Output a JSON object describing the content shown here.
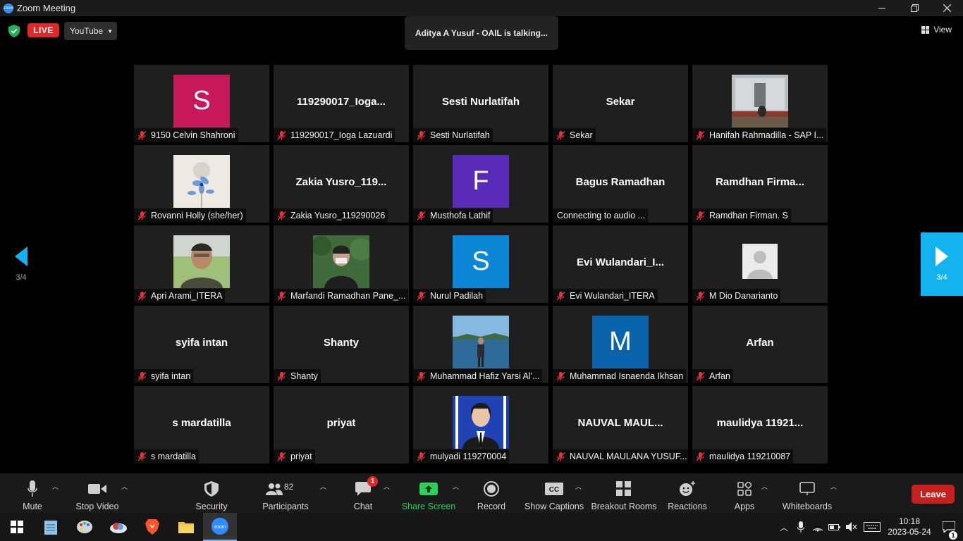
{
  "window": {
    "title": "Zoom Meeting",
    "controls": [
      "minimize",
      "restore",
      "close"
    ]
  },
  "topbar": {
    "live_label": "LIVE",
    "stream_target": "YouTube",
    "talking_banner": "Aditya A Yusuf - OAIL is talking...",
    "view_label": "View"
  },
  "gallery": {
    "tiles": [
      {
        "type": "avatar",
        "initial": "S",
        "color": "#c8185c",
        "label": "9150 Celvin Shahroni",
        "muted": true
      },
      {
        "type": "name",
        "display": "119290017_Ioga...",
        "label": "119290017_Ioga Lazuardi",
        "muted": true
      },
      {
        "type": "name",
        "display": "Sesti Nurlatifah",
        "label": "Sesti Nurlatifah",
        "muted": true
      },
      {
        "type": "name",
        "display": "Sekar",
        "label": "Sekar",
        "muted": true
      },
      {
        "type": "photo",
        "photo": "building-photo",
        "label": "Hanifah Rahmadilla - SAP I...",
        "muted": true
      },
      {
        "type": "photo",
        "photo": "flower-photo",
        "label": "Rovanni Holly (she/her)",
        "muted": true
      },
      {
        "type": "name",
        "display": "Zakia  Yusro_119...",
        "label": "Zakia Yusro_119290026",
        "muted": true
      },
      {
        "type": "avatar",
        "initial": "F",
        "color": "#5a2bb8",
        "label": "Musthofa Lathif",
        "muted": true
      },
      {
        "type": "name",
        "display": "Bagus Ramadhan",
        "label": "Connecting to audio ...",
        "muted": false
      },
      {
        "type": "name",
        "display": "Ramdhan  Firma...",
        "label": "Ramdhan Firman. S",
        "muted": true
      },
      {
        "type": "photo",
        "photo": "selfie-photo",
        "label": "Apri Arami_ITERA",
        "muted": true
      },
      {
        "type": "photo",
        "photo": "forest-photo",
        "label": "Marfandi Ramadhan Pane_...",
        "muted": true
      },
      {
        "type": "avatar",
        "initial": "S",
        "color": "#0d86d6",
        "label": "Nurul Padilah",
        "muted": true
      },
      {
        "type": "name",
        "display": "Evi  Wulandari_I...",
        "label": "Evi Wulandari_ITERA",
        "muted": true
      },
      {
        "type": "photo",
        "photo": "default-user-photo",
        "label": "M Dio Danarianto",
        "muted": true
      },
      {
        "type": "name",
        "display": "syifa intan",
        "label": "syifa intan",
        "muted": true
      },
      {
        "type": "name",
        "display": "Shanty",
        "label": "Shanty",
        "muted": true
      },
      {
        "type": "photo",
        "photo": "sea-photo",
        "label": "Muhammad Hafiz Yarsi Al'...",
        "muted": true
      },
      {
        "type": "avatar",
        "initial": "M",
        "color": "#0b62ad",
        "label": "Muhammad Isnaenda Ikhsan",
        "muted": true
      },
      {
        "type": "name",
        "display": "Arfan",
        "label": "Arfan",
        "muted": true
      },
      {
        "type": "name",
        "display": "s mardatilla",
        "label": "s mardatilla",
        "muted": true
      },
      {
        "type": "name",
        "display": "priyat",
        "label": "priyat",
        "muted": true
      },
      {
        "type": "photo",
        "photo": "portrait-photo",
        "label": "mulyadi 119270004",
        "muted": true
      },
      {
        "type": "name",
        "display": "NAUVAL  MAUL...",
        "label": "NAUVAL MAULANA YUSUF...",
        "muted": true
      },
      {
        "type": "name",
        "display": "maulidya  11921...",
        "label": "maulidya 119210087",
        "muted": true
      }
    ]
  },
  "pagination": {
    "left_page": "3/4",
    "right_page": "3/4"
  },
  "toolbar": {
    "mute": "Mute",
    "stop_video": "Stop Video",
    "security": "Security",
    "participants": "Participants",
    "participants_count": "82",
    "chat": "Chat",
    "chat_badge": "1",
    "share_screen": "Share Screen",
    "record": "Record",
    "show_captions": "Show Captions",
    "breakout_rooms": "Breakout Rooms",
    "reactions": "Reactions",
    "apps": "Apps",
    "whiteboards": "Whiteboards",
    "leave": "Leave"
  },
  "taskbar": {
    "apps": [
      "windows-start",
      "notepad",
      "paint",
      "cloud-app",
      "brave",
      "file-explorer",
      "zoom"
    ],
    "time": "10:18",
    "date": "2023-05-24",
    "notification_count": "1"
  },
  "colors": {
    "live": "#e02828",
    "share_green": "#2ad05b",
    "leave": "#c7211f",
    "page_arrow": "#12b3f0"
  }
}
